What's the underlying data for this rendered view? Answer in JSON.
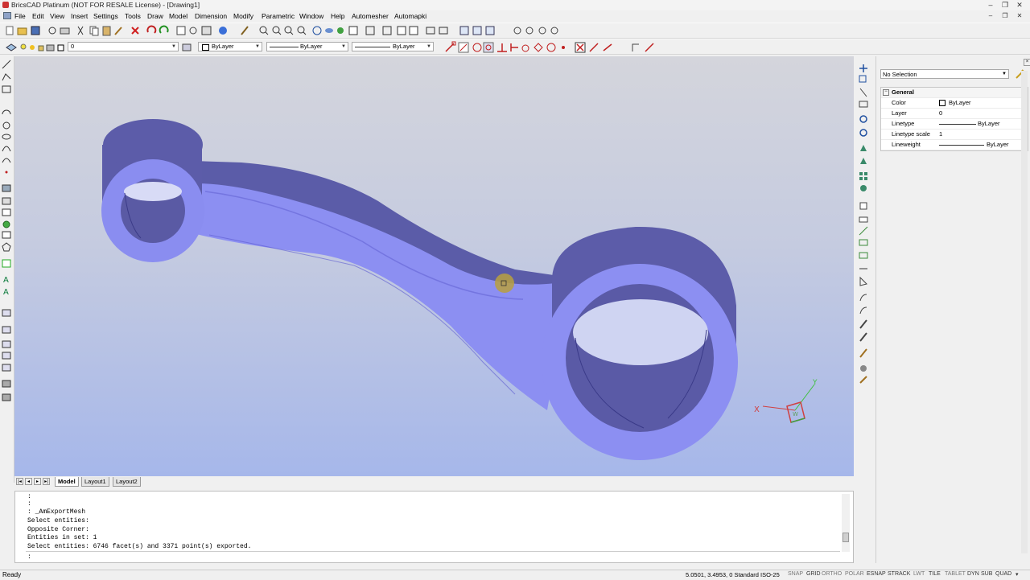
{
  "window": {
    "title": "BricsCAD Platinum (NOT FOR RESALE License) - [Drawing1]",
    "controls": [
      "–",
      "❐",
      "✕"
    ]
  },
  "menu": [
    "File",
    "Edit",
    "View",
    "Insert",
    "Settings",
    "Tools",
    "Draw",
    "Model",
    "Dimension",
    "Modify",
    "Parametric",
    "Window",
    "Help",
    "Automesher",
    "Automapki"
  ],
  "layer_toolbar": {
    "layer_value": "0",
    "color_value": "ByLayer",
    "linetype_value": "ByLayer",
    "lineweight_value": "ByLayer"
  },
  "viewport": {
    "ucs": {
      "x_label": "X",
      "y_label": "Y",
      "w_label": "W"
    },
    "model_colors": {
      "face": "#8a8cf0",
      "side": "#5a5aa6",
      "inner": "#4a4a90"
    }
  },
  "tabs": {
    "items": [
      "Model",
      "Layout1",
      "Layout2"
    ],
    "active": "Model"
  },
  "command_history": [
    ":",
    ":",
    ": _AmExportMesh",
    "Select entities:",
    "Opposite Corner:",
    "Entities in set: 1",
    "Select entities: 6746 facet(s) and 3371 point(s) exported."
  ],
  "command_prompt": ":",
  "properties": {
    "selection": "No Selection",
    "section": "General",
    "rows": [
      {
        "key": "Color",
        "value": "ByLayer"
      },
      {
        "key": "Layer",
        "value": "0"
      },
      {
        "key": "Linetype",
        "value": "ByLayer"
      },
      {
        "key": "Linetype scale",
        "value": "1"
      },
      {
        "key": "Lineweight",
        "value": "ByLayer"
      }
    ]
  },
  "status": {
    "ready": "Ready",
    "coords": "5.0501, 3.4953, 0  Standard  ISO-25",
    "toggles": [
      "SNAP",
      "GRID",
      "ORTHO",
      "POLAR",
      "ESNAP",
      "STRACK",
      "LWT",
      "TILE",
      "TABLET",
      "DYN",
      "SUB",
      "QUAD"
    ]
  }
}
